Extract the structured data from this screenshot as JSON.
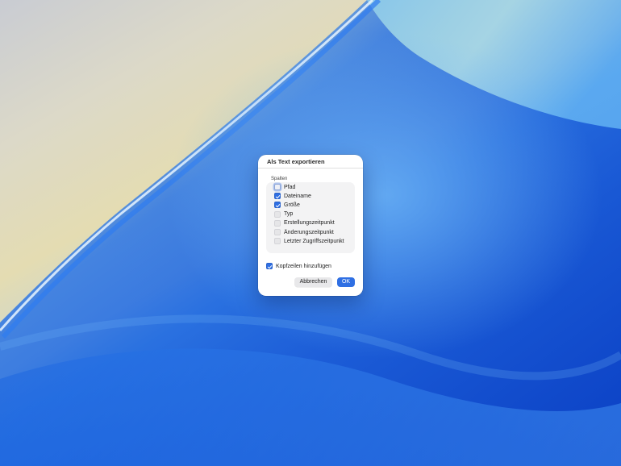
{
  "dialog": {
    "title": "Als Text exportieren",
    "section_label": "Spalten",
    "columns": [
      {
        "label": "Pfad",
        "checked": false,
        "focused": true
      },
      {
        "label": "Dateiname",
        "checked": true,
        "focused": false
      },
      {
        "label": "Größe",
        "checked": true,
        "focused": false
      },
      {
        "label": "Typ",
        "checked": false,
        "focused": false
      },
      {
        "label": "Erstellungszeitpunkt",
        "checked": false,
        "focused": false
      },
      {
        "label": "Änderungszeitpunkt",
        "checked": false,
        "focused": false
      },
      {
        "label": "Letzter Zugriffszeitpunkt",
        "checked": false,
        "focused": false
      }
    ],
    "add_headers": {
      "label": "Kopfzeilen hinzufügen",
      "checked": true
    },
    "cancel_label": "Abbrechen",
    "ok_label": "OK"
  },
  "colors": {
    "accent": "#2f6fe3",
    "wallpaper_deep_blue": "#0c45c9",
    "wallpaper_cream": "#e4dcb2"
  }
}
